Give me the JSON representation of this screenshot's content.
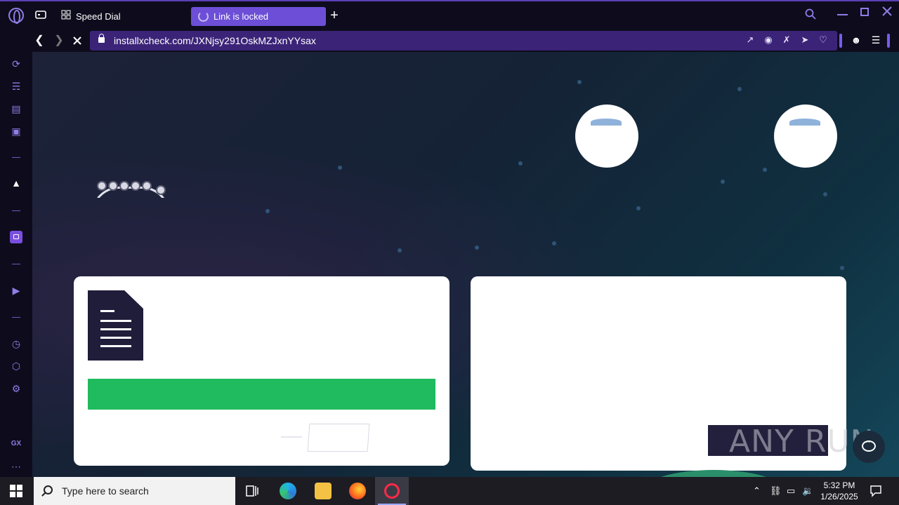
{
  "browser": {
    "tabs": [
      {
        "label": "Speed Dial"
      },
      {
        "label": "Link is locked"
      }
    ],
    "url": "installxcheck.com/JXNjsy291OskMZJxnYYsax"
  },
  "page": {
    "watermark": "ANY RUN"
  },
  "taskbar": {
    "search_placeholder": "Type here to search",
    "time": "5:32 PM",
    "date": "1/26/2025"
  },
  "colors": {
    "accent": "#6c4fd6",
    "green_button": "#20bb5e",
    "dark_button": "#22203c"
  }
}
